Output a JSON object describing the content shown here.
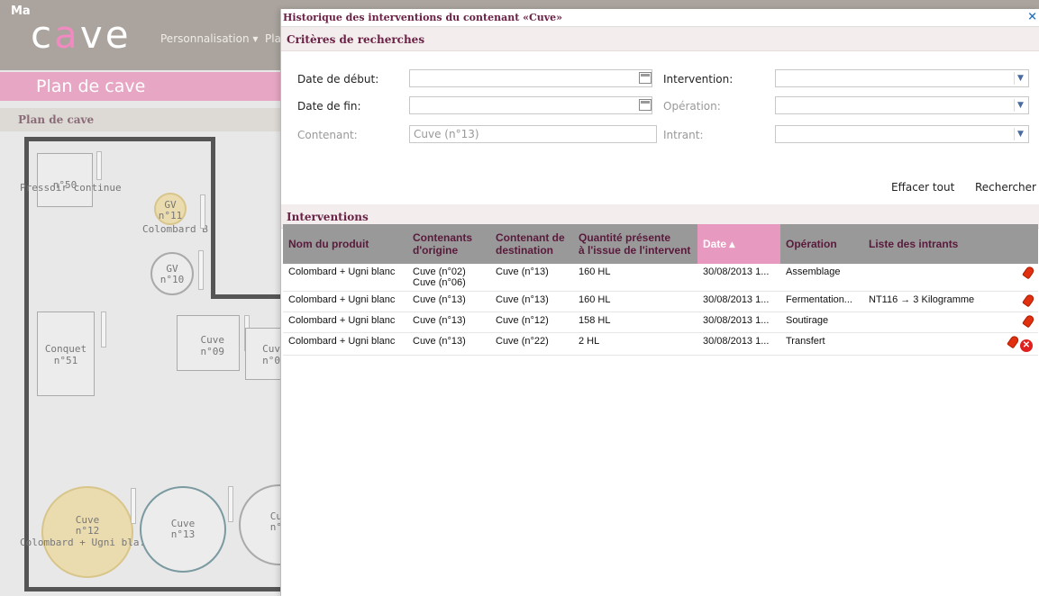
{
  "background_app": {
    "logo_small": "Ma",
    "logo_big_left": "c",
    "logo_big_mid": "a",
    "logo_big_right": "ve",
    "nav_item": "Personnalisation ▾",
    "nav_item_cut": "Pla",
    "banner": "Plan de cave",
    "subheader": "Plan de cave",
    "plan_items": {
      "pressoir": "Pressoir continue",
      "pressoir_num": "n°50",
      "gv11_a": "GV",
      "gv11_b": "n°11",
      "gv11_label": "Colombard B",
      "gv10_a": "GV",
      "gv10_b": "n°10",
      "conquet_a": "Conquet",
      "conquet_b": "n°51",
      "cuve09_a": "Cuve",
      "cuve09_b": "n°09",
      "cuve_cut_a": "Cuv",
      "cuve_cut_b": "n°0",
      "cuve12_a": "Cuve",
      "cuve12_b": "n°12",
      "cuve12_label": "Colombard + Ugni bla...",
      "cuve13_a": "Cuve",
      "cuve13_b": "n°13",
      "cuve_cut2_a": "Cu",
      "cuve_cut2_b": "n°"
    }
  },
  "dialog": {
    "title": "Historique des interventions du contenant «Cuve»",
    "close": "×",
    "criteria_title": "Critères de recherches",
    "fields": {
      "date_debut_label": "Date de début:",
      "date_debut_value": "",
      "date_fin_label": "Date de fin:",
      "date_fin_value": "",
      "contenant_label": "Contenant:",
      "contenant_value": "Cuve (n°13)",
      "intervention_label": "Intervention:",
      "intervention_value": "",
      "operation_label": "Opération:",
      "operation_value": "",
      "intrant_label": "Intrant:",
      "intrant_value": ""
    },
    "clear_all": "Effacer tout",
    "search": "Rechercher",
    "interventions_title": "Interventions",
    "columns": {
      "produit": "Nom du produit",
      "origine_1": "Contenants",
      "origine_2": "d'origine",
      "destination_1": "Contenant de",
      "destination_2": "destination",
      "quantite_1": "Quantité présente",
      "quantite_2": "à l'issue de l'intervent",
      "date": "Date ▴",
      "operation": "Opération",
      "intrants": "Liste des intrants"
    },
    "rows": [
      {
        "produit": "Colombard + Ugni blanc",
        "origine": "Cuve (n°02)",
        "origine2": "Cuve (n°06)",
        "destination": "Cuve (n°13)",
        "quantite": "160 HL",
        "date": "30/08/2013 1...",
        "operation": "Assemblage",
        "intrants": ""
      },
      {
        "produit": "Colombard + Ugni blanc",
        "origine": "Cuve (n°13)",
        "origine2": "",
        "destination": "Cuve (n°13)",
        "quantite": "160 HL",
        "date": "30/08/2013 1...",
        "operation": "Fermentation...",
        "intrants": "NT116 → 3 Kilogramme"
      },
      {
        "produit": "Colombard + Ugni blanc",
        "origine": "Cuve (n°13)",
        "origine2": "",
        "destination": "Cuve (n°12)",
        "quantite": "158 HL",
        "date": "30/08/2013 1...",
        "operation": "Soutirage",
        "intrants": ""
      },
      {
        "produit": "Colombard + Ugni blanc",
        "origine": "Cuve (n°13)",
        "origine2": "",
        "destination": "Cuve (n°22)",
        "quantite": "2 HL",
        "date": "30/08/2013 1...",
        "operation": "Transfert",
        "intrants": ""
      }
    ]
  }
}
